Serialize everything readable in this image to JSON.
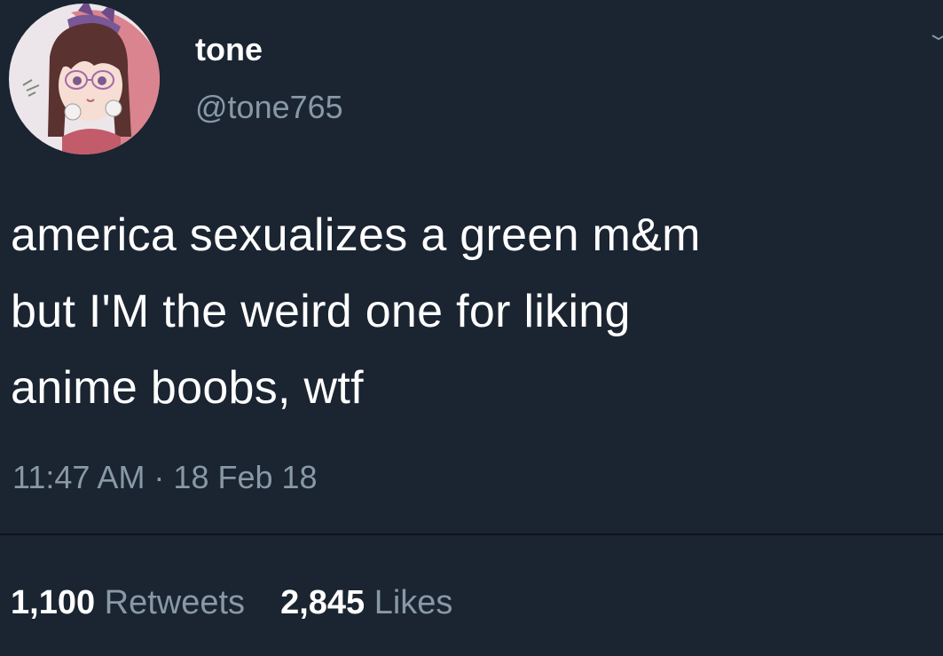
{
  "user": {
    "display_name": "tone",
    "handle": "@tone765",
    "avatar_icon": "anime-avatar"
  },
  "tweet": {
    "text_lines": [
      "america sexualizes a green m&m",
      "but I'M the weird one for liking",
      "anime boobs, wtf"
    ],
    "timestamp": "11:47 AM · 18 Feb 18"
  },
  "stats": {
    "retweets_count": "1,100",
    "retweets_label": "Retweets",
    "likes_count": "2,845",
    "likes_label": "Likes"
  },
  "colors": {
    "background": "#1b2431",
    "primary_text": "#ffffff",
    "secondary_text": "#8899a6"
  }
}
